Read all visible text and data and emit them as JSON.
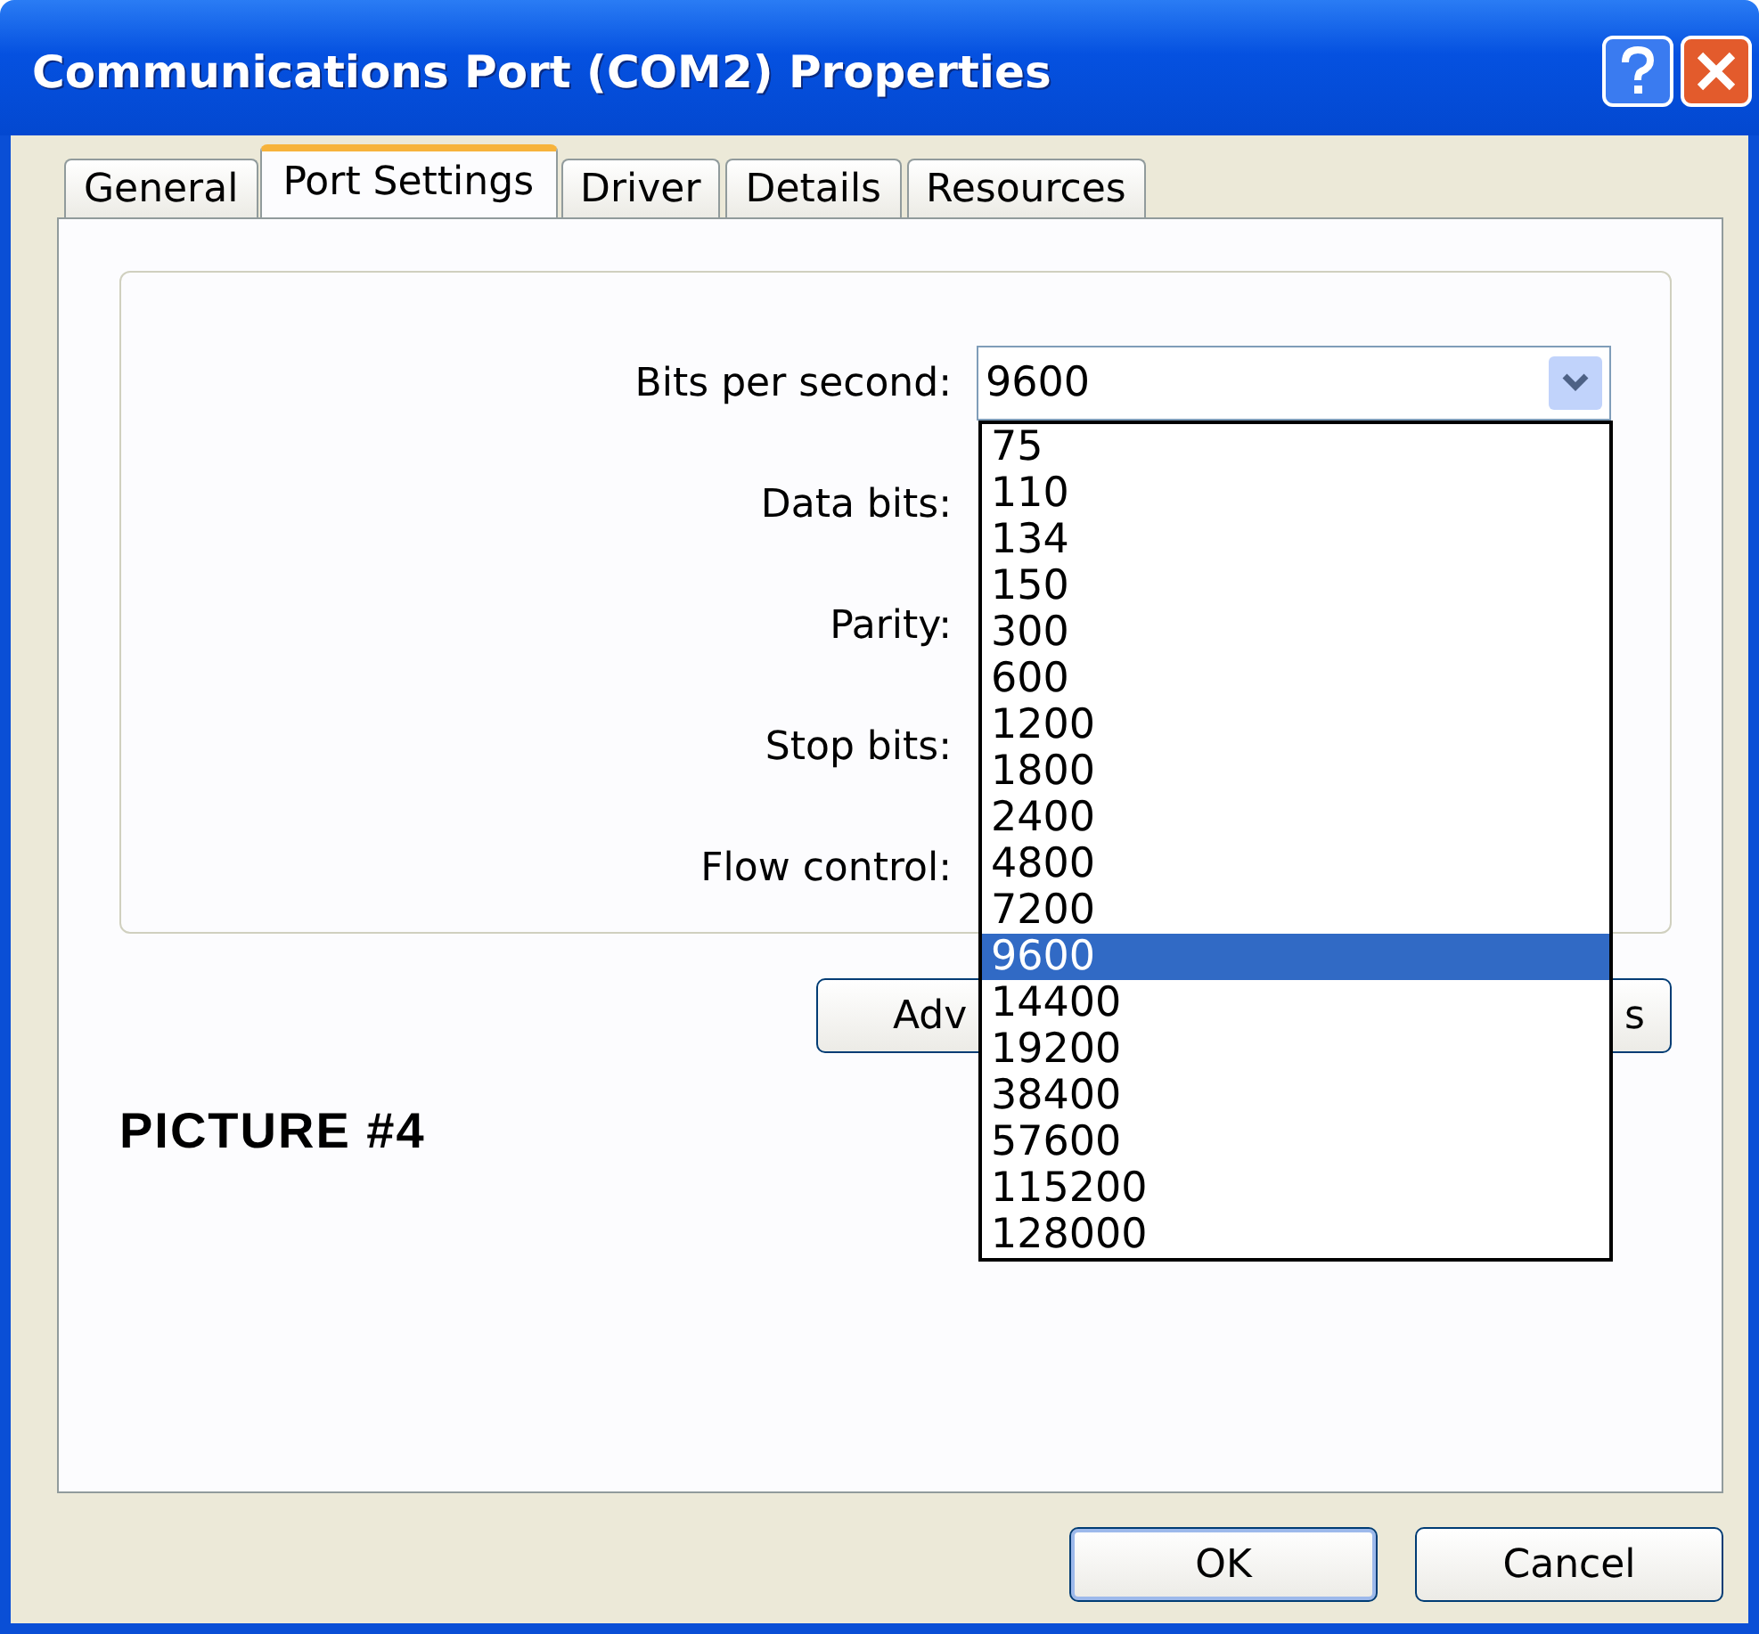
{
  "window": {
    "title": "Communications Port (COM2) Properties",
    "title_buttons": [
      {
        "kind": "help"
      },
      {
        "kind": "close"
      }
    ]
  },
  "tabs": [
    {
      "label": "General",
      "selected": false
    },
    {
      "label": "Port Settings",
      "selected": true
    },
    {
      "label": "Driver",
      "selected": false
    },
    {
      "label": "Details",
      "selected": false
    },
    {
      "label": "Resources",
      "selected": false
    }
  ],
  "settings": [
    {
      "label": "Bits per second:",
      "value": "9600",
      "expanded": true
    },
    {
      "label": "Data bits:"
    },
    {
      "label": "Parity:"
    },
    {
      "label": "Stop bits:"
    },
    {
      "label": "Flow control:"
    }
  ],
  "dropdown_options": [
    {
      "label": "75",
      "selected": false
    },
    {
      "label": "110",
      "selected": false
    },
    {
      "label": "134",
      "selected": false
    },
    {
      "label": "150",
      "selected": false
    },
    {
      "label": "300",
      "selected": false
    },
    {
      "label": "600",
      "selected": false
    },
    {
      "label": "1200",
      "selected": false
    },
    {
      "label": "1800",
      "selected": false
    },
    {
      "label": "2400",
      "selected": false
    },
    {
      "label": "4800",
      "selected": false
    },
    {
      "label": "7200",
      "selected": false
    },
    {
      "label": "9600",
      "selected": true
    },
    {
      "label": "14400",
      "selected": false
    },
    {
      "label": "19200",
      "selected": false
    },
    {
      "label": "38400",
      "selected": false
    },
    {
      "label": "57600",
      "selected": false
    },
    {
      "label": "115200",
      "selected": false
    },
    {
      "label": "128000",
      "selected": false
    }
  ],
  "group_buttons": [
    {
      "label": "Adv",
      "kind": "leading"
    },
    {
      "label": "s",
      "kind": "trailing"
    }
  ],
  "annotation": "PICTURE #4",
  "dialog_buttons": [
    {
      "label": "OK",
      "default": true
    },
    {
      "label": "Cancel",
      "default": false
    }
  ]
}
